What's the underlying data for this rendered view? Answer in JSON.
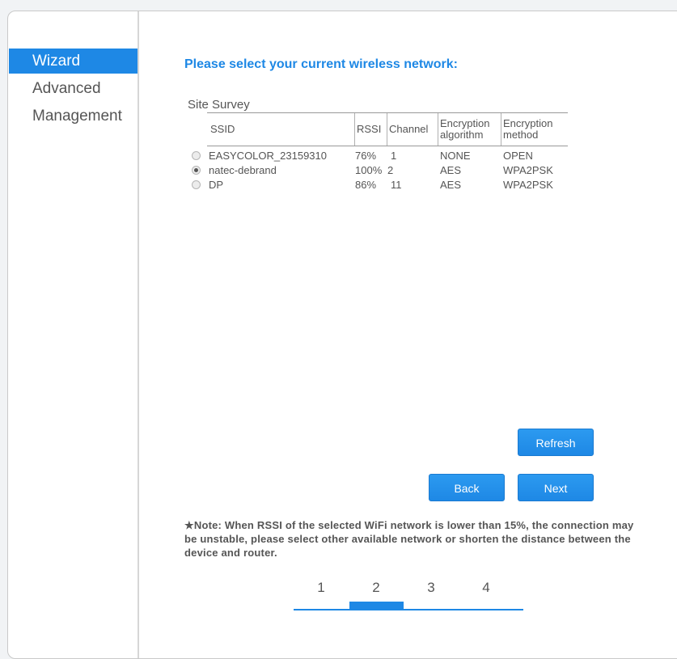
{
  "sidebar": {
    "items": [
      {
        "label": "Wizard",
        "active": true
      },
      {
        "label": "Advanced",
        "active": false
      },
      {
        "label": "Management",
        "active": false
      }
    ]
  },
  "main": {
    "heading": "Please select your current wireless network:",
    "survey_label": "Site Survey",
    "table": {
      "headers": {
        "ssid": "SSID",
        "rssi": "RSSI",
        "channel": "Channel",
        "enc_alg": "Encryption algorithm",
        "enc_method": "Encryption method"
      },
      "rows": [
        {
          "ssid": "EASYCOLOR_2315931076%",
          "ssid_text": "EASYCOLOR_23159310",
          "rssi": "76%",
          "channel": "1",
          "enc_alg": "NONE",
          "enc_method": "OPEN",
          "selected": false
        },
        {
          "ssid_text": "natec-debrand",
          "rssi": "100%",
          "channel": "2",
          "enc_alg": "AES",
          "enc_method": "WPA2PSK",
          "selected": true
        },
        {
          "ssid_text": "DP",
          "rssi": "86%",
          "channel": "11",
          "enc_alg": "AES",
          "enc_method": "WPA2PSK",
          "selected": false
        }
      ]
    },
    "buttons": {
      "refresh": "Refresh",
      "back": "Back",
      "next": "Next"
    },
    "note": "★Note: When RSSI of the selected WiFi network is lower than 15%, the connection may be unstable, please select other available network or shorten the distance between the device and router.",
    "steps": [
      "1",
      "2",
      "3",
      "4"
    ],
    "current_step": "2"
  },
  "colors": {
    "accent": "#1e88e5",
    "text": "#555555"
  }
}
